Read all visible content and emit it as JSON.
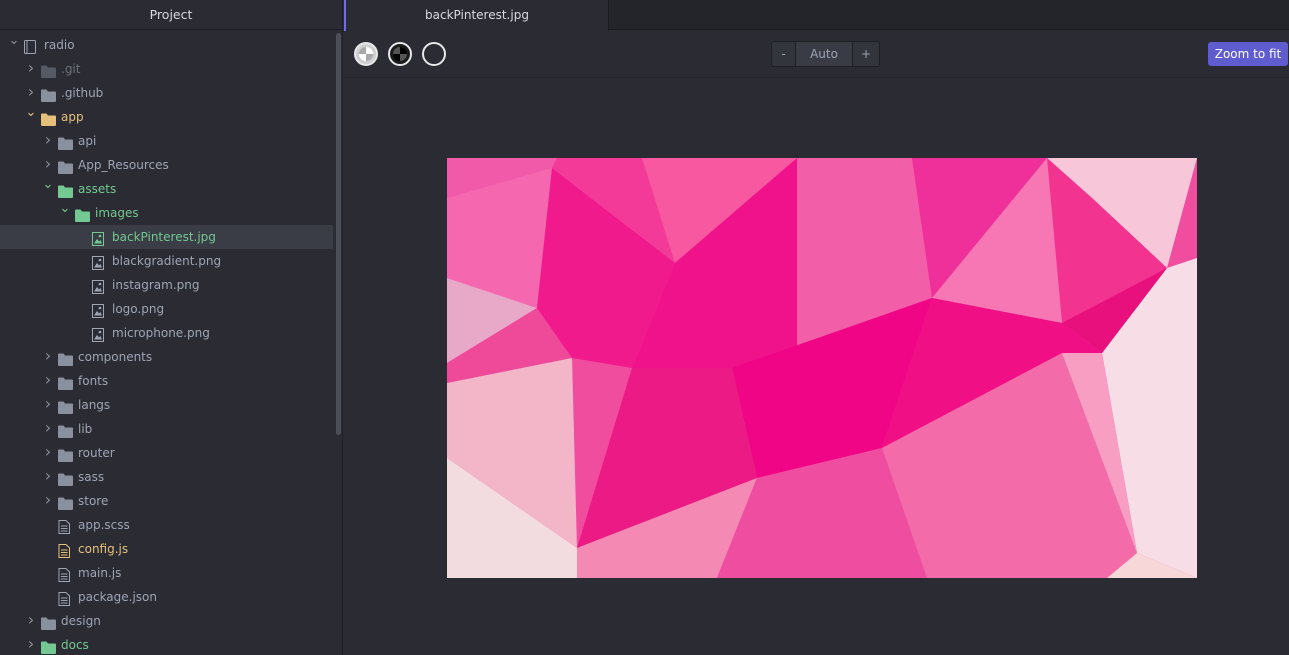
{
  "sidebar": {
    "title": "Project",
    "tree": [
      {
        "label": "radio",
        "type": "project",
        "depth": 0,
        "expanded": true,
        "color": "default"
      },
      {
        "label": ".git",
        "type": "folder",
        "depth": 1,
        "expanded": false,
        "color": "muted"
      },
      {
        "label": ".github",
        "type": "folder",
        "depth": 1,
        "expanded": false,
        "color": "default"
      },
      {
        "label": "app",
        "type": "folder",
        "depth": 1,
        "expanded": true,
        "color": "yellow"
      },
      {
        "label": "api",
        "type": "folder",
        "depth": 2,
        "expanded": false,
        "color": "default"
      },
      {
        "label": "App_Resources",
        "type": "folder",
        "depth": 2,
        "expanded": false,
        "color": "default"
      },
      {
        "label": "assets",
        "type": "folder",
        "depth": 2,
        "expanded": true,
        "color": "green"
      },
      {
        "label": "images",
        "type": "folder",
        "depth": 3,
        "expanded": true,
        "color": "green"
      },
      {
        "label": "backPinterest.jpg",
        "type": "image",
        "depth": 4,
        "color": "green",
        "selected": true
      },
      {
        "label": "blackgradient.png",
        "type": "image",
        "depth": 4,
        "color": "default"
      },
      {
        "label": "instagram.png",
        "type": "image",
        "depth": 4,
        "color": "default"
      },
      {
        "label": "logo.png",
        "type": "image",
        "depth": 4,
        "color": "default"
      },
      {
        "label": "microphone.png",
        "type": "image",
        "depth": 4,
        "color": "default"
      },
      {
        "label": "components",
        "type": "folder",
        "depth": 2,
        "expanded": false,
        "color": "default"
      },
      {
        "label": "fonts",
        "type": "folder",
        "depth": 2,
        "expanded": false,
        "color": "default"
      },
      {
        "label": "langs",
        "type": "folder",
        "depth": 2,
        "expanded": false,
        "color": "default"
      },
      {
        "label": "lib",
        "type": "folder",
        "depth": 2,
        "expanded": false,
        "color": "default"
      },
      {
        "label": "router",
        "type": "folder",
        "depth": 2,
        "expanded": false,
        "color": "default"
      },
      {
        "label": "sass",
        "type": "folder",
        "depth": 2,
        "expanded": false,
        "color": "default"
      },
      {
        "label": "store",
        "type": "folder",
        "depth": 2,
        "expanded": false,
        "color": "default"
      },
      {
        "label": "app.scss",
        "type": "file",
        "depth": 2,
        "color": "default"
      },
      {
        "label": "config.js",
        "type": "file",
        "depth": 2,
        "color": "yellow"
      },
      {
        "label": "main.js",
        "type": "file",
        "depth": 2,
        "color": "default"
      },
      {
        "label": "package.json",
        "type": "file",
        "depth": 2,
        "color": "default"
      },
      {
        "label": "design",
        "type": "folder",
        "depth": 1,
        "expanded": false,
        "color": "default"
      },
      {
        "label": "docs",
        "type": "folder",
        "depth": 1,
        "expanded": false,
        "color": "green"
      }
    ]
  },
  "tabs": [
    {
      "label": "backPinterest.jpg",
      "active": true
    }
  ],
  "toolbar": {
    "zoom_minus": "-",
    "zoom_level": "Auto",
    "zoom_plus": "+",
    "zoom_fit": "Zoom to fit",
    "backgrounds": [
      "white-checker",
      "black-checker",
      "transparent"
    ]
  },
  "colors": {
    "accent": "#5e5ccf",
    "tab_indicator": "#6e6ee6",
    "git_green": "#73c991",
    "git_yellow": "#e5c07b"
  }
}
